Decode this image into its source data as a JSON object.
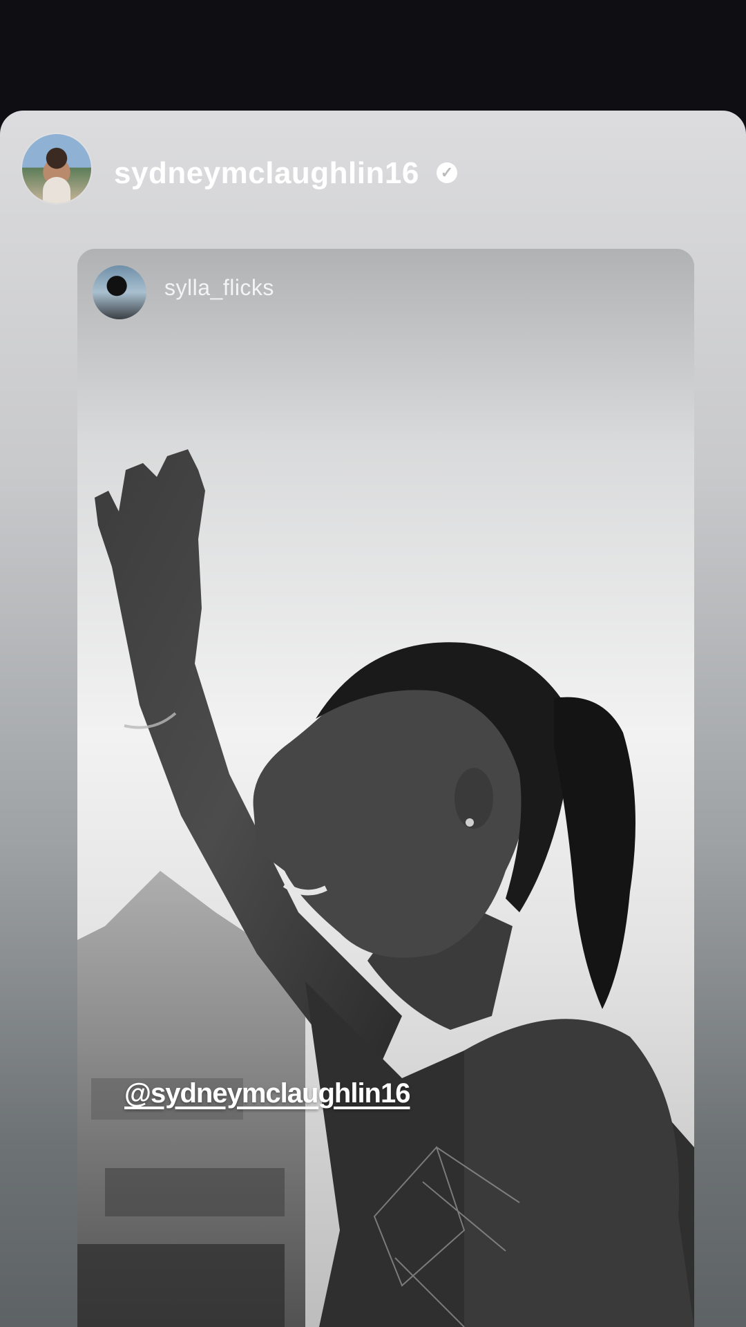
{
  "story": {
    "author": {
      "username": "sydneymclaughlin16",
      "verified_mark": "✓",
      "avatar_icon": "profile-avatar"
    },
    "shared_post": {
      "author": {
        "username": "sylla_flicks",
        "avatar_icon": "camera-person-avatar"
      },
      "mention_sticker": "@sydneymclaughlin16"
    }
  },
  "colors": {
    "background": "#0f0f13",
    "card_top": "#dcdcde",
    "card_bottom": "#5d6265",
    "text": "#ffffff"
  }
}
